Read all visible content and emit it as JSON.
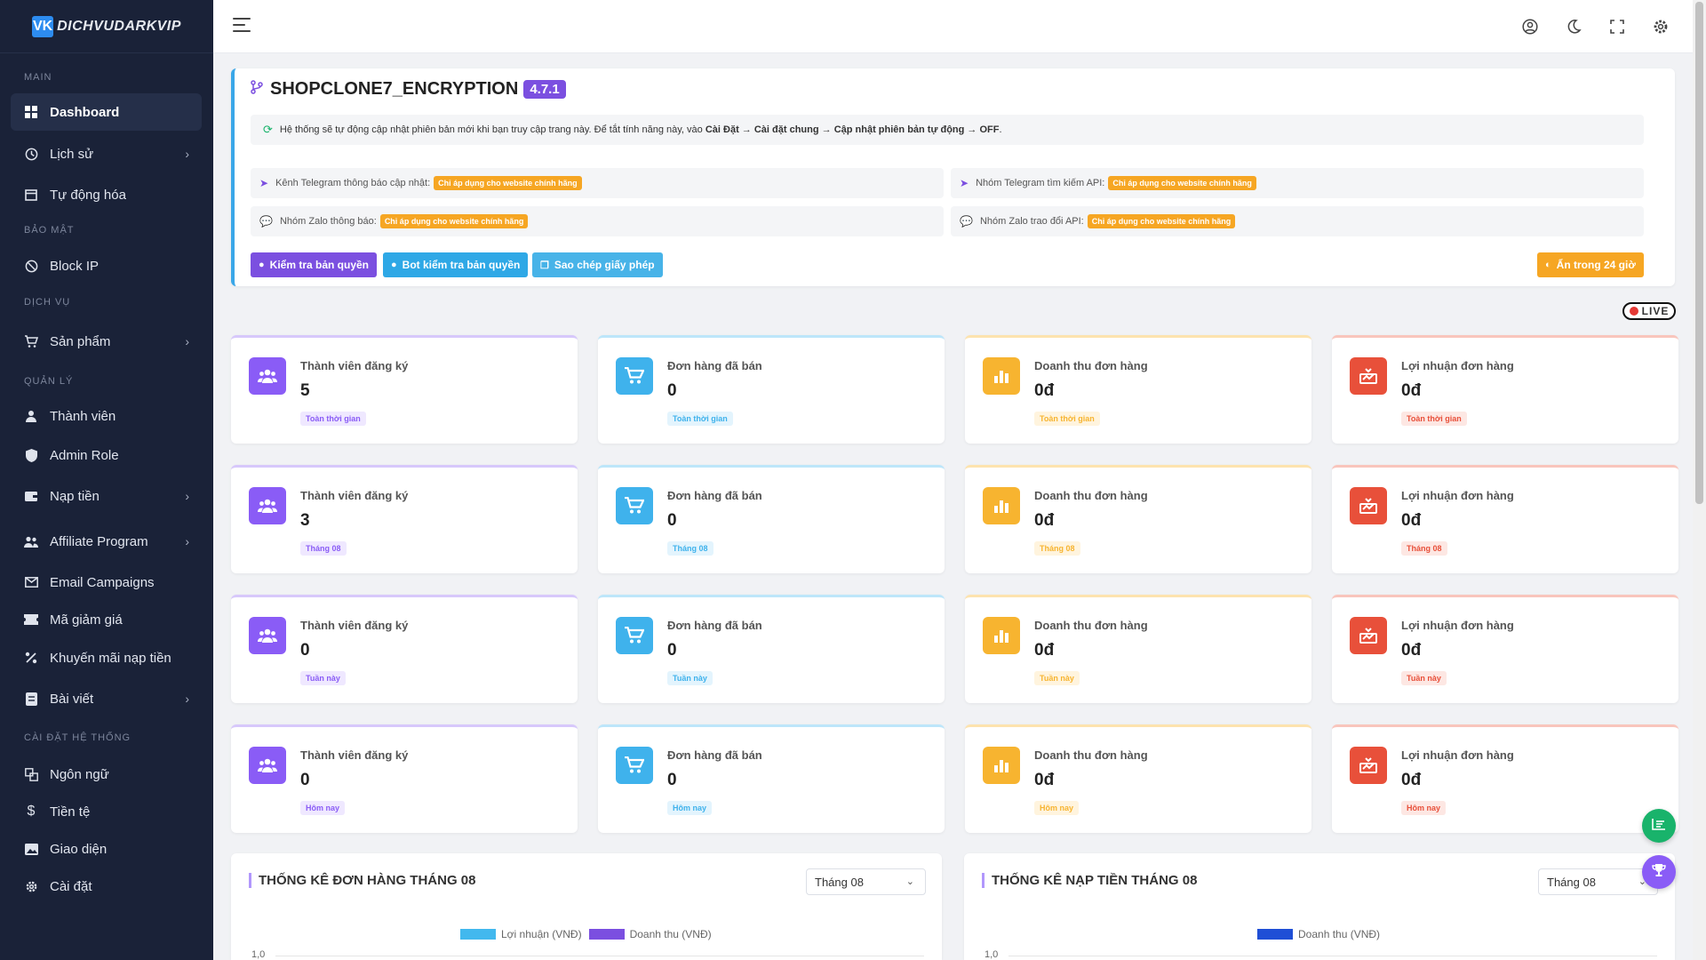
{
  "brand": {
    "logo_mark": "VK",
    "logo_text": "DICHVUDARKVIP"
  },
  "sidebar": {
    "sections": {
      "main": "MAIN",
      "security": "BẢO MẬT",
      "service": "DỊCH VỤ",
      "manage": "QUẢN LÝ",
      "settings": "CÀI ĐẶT HỆ THỐNG"
    },
    "items": [
      {
        "label": "Dashboard",
        "icon": "dashboard-icon"
      },
      {
        "label": "Lịch sử",
        "icon": "history-icon"
      },
      {
        "label": "Tự động hóa",
        "icon": "calendar-icon"
      },
      {
        "label": "Block IP",
        "icon": "block-icon"
      },
      {
        "label": "Sản phẩm",
        "icon": "cart-icon"
      },
      {
        "label": "Thành viên",
        "icon": "user-icon"
      },
      {
        "label": "Admin Role",
        "icon": "shield-icon"
      },
      {
        "label": "Nạp tiền",
        "icon": "wallet-icon"
      },
      {
        "label": "Affiliate Program",
        "icon": "users-icon"
      },
      {
        "label": "Email Campaigns",
        "icon": "mail-icon"
      },
      {
        "label": "Mã giảm giá",
        "icon": "coupon-icon"
      },
      {
        "label": "Khuyến mãi nạp tiền",
        "icon": "percent-icon"
      },
      {
        "label": "Bài viết",
        "icon": "post-icon"
      },
      {
        "label": "Ngôn ngữ",
        "icon": "language-icon"
      },
      {
        "label": "Tiền tệ",
        "icon": "dollar-icon"
      },
      {
        "label": "Giao diện",
        "icon": "image-icon"
      },
      {
        "label": "Cài đặt",
        "icon": "gear-icon"
      }
    ]
  },
  "update": {
    "title": "SHOPCLONE7_ENCRYPTION",
    "version": "4.7.1",
    "notice_prefix": "Hệ thống sẽ tự động cập nhật phiên bản mới khi bạn truy cập trang này. Để tắt tính năng này, vào",
    "notice_path": "Cài Đặt → Cài đặt chung → Cập nhật phiên bản tự động → OFF",
    "notice_suffix": ".",
    "info": [
      {
        "label": "Kênh Telegram thông báo cập nhật:",
        "badge": "Chỉ áp dụng cho website chính hãng"
      },
      {
        "label": "Nhóm Telegram tìm kiếm API:",
        "badge": "Chỉ áp dụng cho website chính hãng"
      },
      {
        "label": "Nhóm Zalo thông báo:",
        "badge": "Chỉ áp dụng cho website chính hãng"
      },
      {
        "label": "Nhóm Zalo trao đổi API:",
        "badge": "Chỉ áp dụng cho website chính hãng"
      }
    ],
    "buttons": {
      "check": "Kiểm tra bản quyền",
      "bot": "Bot kiểm tra bản quyền",
      "copy": "Sao chép giấy phép",
      "hide": "Ẩn trong 24 giờ"
    }
  },
  "live_label": "LIVE",
  "stats_rows": [
    {
      "badge": "Toàn thời gian",
      "values": [
        "5",
        "0",
        "0đ",
        "0đ"
      ]
    },
    {
      "badge": "Tháng 08",
      "values": [
        "3",
        "0",
        "0đ",
        "0đ"
      ]
    },
    {
      "badge": "Tuần này",
      "values": [
        "0",
        "0",
        "0đ",
        "0đ"
      ]
    },
    {
      "badge": "Hôm nay",
      "values": [
        "0",
        "0",
        "0đ",
        "0đ"
      ]
    }
  ],
  "stat_labels": [
    "Thành viên đăng ký",
    "Đơn hàng đã bán",
    "Doanh thu đơn hàng",
    "Lợi nhuận đơn hàng"
  ],
  "stat_colors": [
    "#8a5cf6",
    "#3fb2ec",
    "#f7b430",
    "#e8503a"
  ],
  "charts": {
    "orders": {
      "title": "THỐNG KÊ ĐƠN HÀNG THÁNG 08",
      "select": "Tháng 08",
      "legend": [
        "Lợi nhuận (VNĐ)",
        "Doanh thu (VNĐ)"
      ],
      "legend_colors": [
        "#42b8ee",
        "#7b4fe0"
      ],
      "y_top": "1,0"
    },
    "topup": {
      "title": "THỐNG KÊ NẠP TIỀN THÁNG 08",
      "select": "Tháng 08",
      "legend": [
        "Doanh thu (VNĐ)"
      ],
      "legend_colors": [
        "#1f4fd6"
      ],
      "y_top": "1,0"
    }
  }
}
